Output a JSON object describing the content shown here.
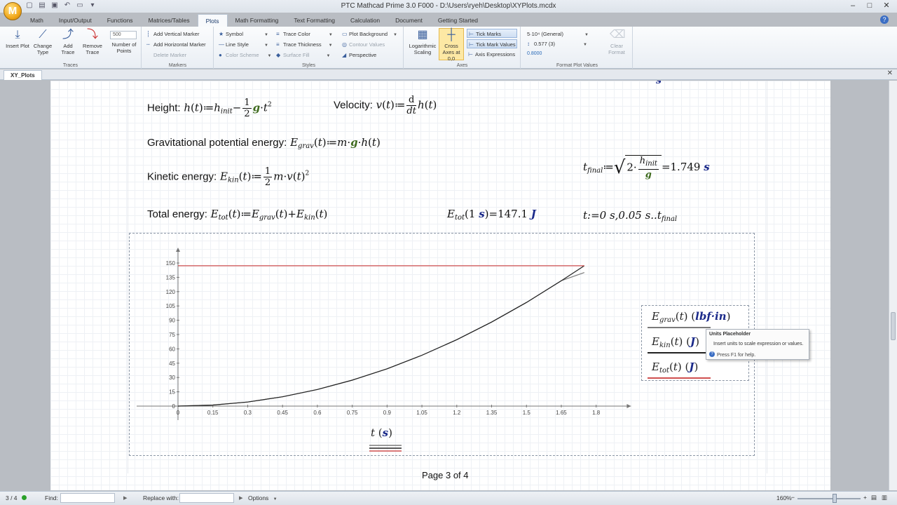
{
  "window": {
    "title": "PTC Mathcad Prime 3.0 F000 - D:\\Users\\ryeh\\Desktop\\XYPlots.mcdx",
    "logo_letter": "M"
  },
  "tabs": [
    "Math",
    "Input/Output",
    "Functions",
    "Matrices/Tables",
    "Plots",
    "Math Formatting",
    "Text Formatting",
    "Calculation",
    "Document",
    "Getting Started"
  ],
  "ribbon": {
    "traces": {
      "label": "Traces",
      "insert_plot": "Insert Plot",
      "change_type": "Change Type",
      "add_trace": "Add Trace",
      "remove_trace": "Remove Trace",
      "number_of_points": "Number of Points",
      "points_value": "500"
    },
    "markers": {
      "label": "Markers",
      "add_vertical": "Add Vertical Marker",
      "add_horizontal": "Add Horizontal Marker",
      "delete": "Delete Marker"
    },
    "styles": {
      "label": "Styles",
      "symbol": "Symbol",
      "line_style": "Line Style",
      "color_scheme": "Color Scheme",
      "trace_color": "Trace Color",
      "trace_thickness": "Trace Thickness",
      "surface_fill": "Surface Fill",
      "plot_background": "Plot Background",
      "contour_values": "Contour Values",
      "perspective": "Perspective"
    },
    "axes": {
      "label": "Axes",
      "log_scaling": "Logarithmic Scaling",
      "cross_axes": "Cross Axes at 0,0",
      "tick_marks": "Tick Marks",
      "tick_mark_values": "Tick Mark Values",
      "axis_expressions": "Axis Expressions"
    },
    "format": {
      "label": "Format Plot Values",
      "format_value": "5·10⁴ (General)",
      "precision_value": "0.577 (3)",
      "sample": "0.8000",
      "clear_format": "Clear Format"
    }
  },
  "document_tab": "XY_Plots",
  "worksheet": {
    "height_label": "Height:",
    "velocity_label": "Velocity:",
    "grav_label": "Gravitational potential energy:",
    "kin_label": "Kinetic energy:",
    "total_label": "Total energy:",
    "etot_result": "147.1",
    "etot_unit": "J",
    "tfinal_result": "1.749",
    "tfinal_unit": "s",
    "range_def": "t:=0 s,0.05 s..t",
    "page_footer": "Page 3 of 4"
  },
  "legend": {
    "grav_units": "lbf·in",
    "kin_units": "J",
    "tot_units": "J"
  },
  "tooltip": {
    "title": "Units Placeholder",
    "body": "Insert units to scale expression or values.",
    "help": "Press F1 for help."
  },
  "chart_data": {
    "type": "line",
    "xlabel": "t (s)",
    "x_ticks": [
      0,
      0.15,
      0.3,
      0.45,
      0.6,
      0.75,
      0.9,
      1.05,
      1.2,
      1.35,
      1.5,
      1.65,
      1.8
    ],
    "y_ticks": [
      0,
      15,
      30,
      45,
      60,
      75,
      90,
      105,
      120,
      135,
      150
    ],
    "xlim": [
      0,
      1.95
    ],
    "ylim": [
      0,
      160
    ],
    "x": [
      0,
      0.15,
      0.3,
      0.45,
      0.6,
      0.75,
      0.9,
      1.05,
      1.2,
      1.35,
      1.5,
      1.65,
      1.749
    ],
    "series": [
      {
        "name": "E_grav(t) (lbf·in)",
        "color": "#7a7a7a",
        "values": [
          0,
          1.1,
          4.3,
          9.8,
          17.4,
          27.2,
          39.1,
          53.3,
          69.6,
          88.1,
          108.7,
          131.5,
          140.0
        ]
      },
      {
        "name": "E_kin(t) (J)",
        "color": "#222222",
        "values": [
          0,
          1.1,
          4.3,
          9.8,
          17.4,
          27.2,
          39.1,
          53.3,
          69.6,
          88.1,
          108.7,
          131.5,
          147.1
        ]
      },
      {
        "name": "E_tot(t) (J)",
        "color": "#d05050",
        "values": [
          147.1,
          147.1,
          147.1,
          147.1,
          147.1,
          147.1,
          147.1,
          147.1,
          147.1,
          147.1,
          147.1,
          147.1,
          147.1
        ]
      }
    ]
  },
  "status": {
    "page": "3 / 4",
    "find": "Find:",
    "replace": "Replace with:",
    "options": "Options",
    "zoom": "160%"
  }
}
